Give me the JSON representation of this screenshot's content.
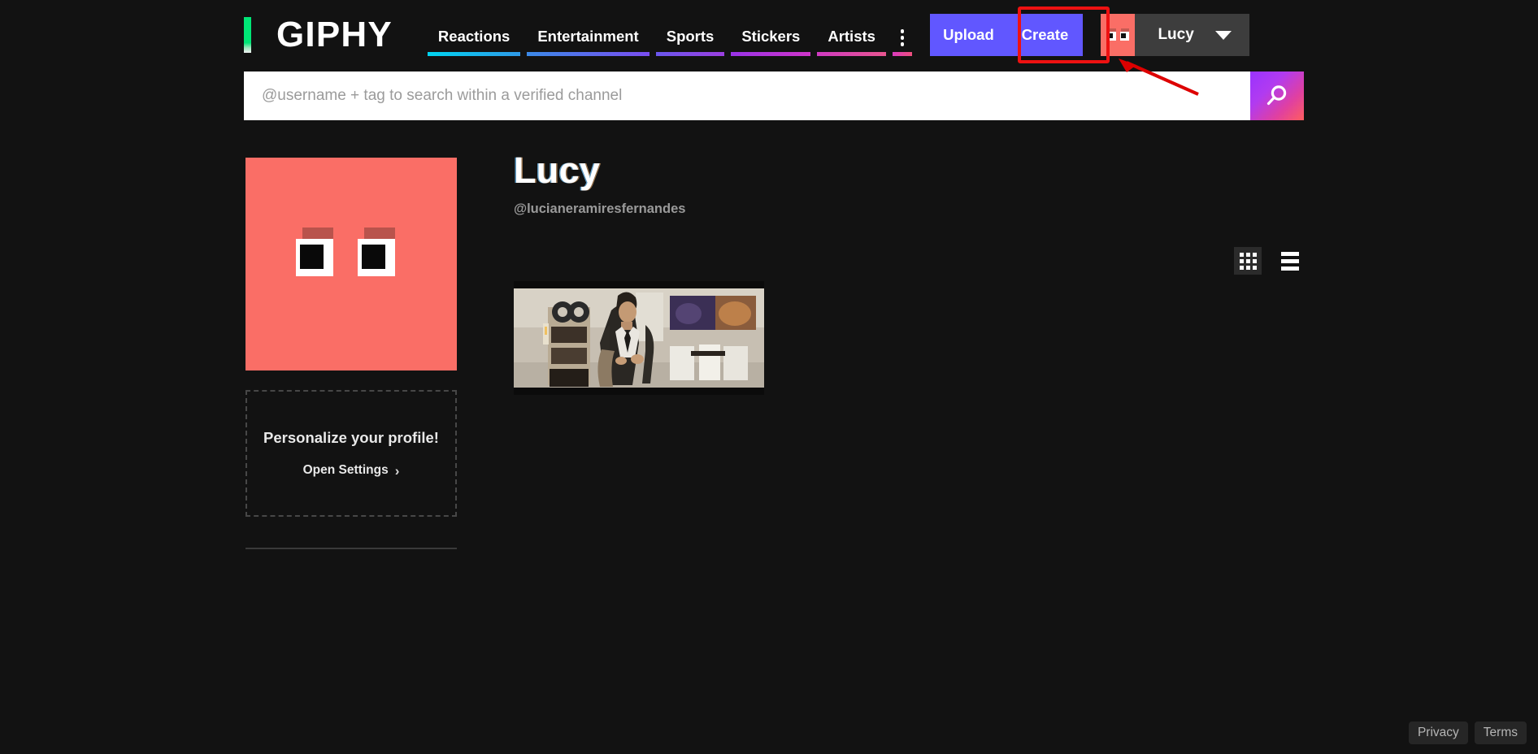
{
  "header": {
    "logo_text": "GIPHY",
    "nav_items": [
      {
        "label": "Reactions",
        "underline_from": "#00d4f0",
        "underline_to": "#2f9ae8"
      },
      {
        "label": "Entertainment",
        "underline_from": "#3b8ae8",
        "underline_to": "#7a4df0"
      },
      {
        "label": "Sports",
        "underline_from": "#6a57ee",
        "underline_to": "#9b3fe0"
      },
      {
        "label": "Stickers",
        "underline_from": "#9933e8",
        "underline_to": "#cf35c9"
      },
      {
        "label": "Artists",
        "underline_from": "#cf3ac2",
        "underline_to": "#e8558f"
      }
    ],
    "more_menu": {
      "icon": "vertical-ellipsis-icon",
      "underline_from": "#d93bbf",
      "underline_to": "#ee4f7d"
    },
    "upload_label": "Upload",
    "create_label": "Create",
    "user_name": "Lucy",
    "accent_button_color": "#6157ff",
    "highlight_color": "#ee1111"
  },
  "search": {
    "placeholder": "@username + tag to search within a verified channel",
    "value": "",
    "button_icon": "search-icon"
  },
  "sidebar": {
    "avatar_color": "#fa6e66",
    "personalize_title": "Personalize your profile!",
    "personalize_link": "Open Settings",
    "chevron": "›"
  },
  "profile": {
    "display_name": "Lucy",
    "handle": "@lucianeramiresfernandes"
  },
  "view_toggle": {
    "grid_icon": "grid-view-icon",
    "list_icon": "list-view-icon",
    "active": "grid"
  },
  "gifs": [
    {
      "alt": "confused-man-in-suit-looking-around-living-room"
    }
  ],
  "footer": {
    "privacy_label": "Privacy",
    "terms_label": "Terms"
  },
  "annotation": {
    "arrow_color": "#dd0000",
    "target": "create-button"
  }
}
